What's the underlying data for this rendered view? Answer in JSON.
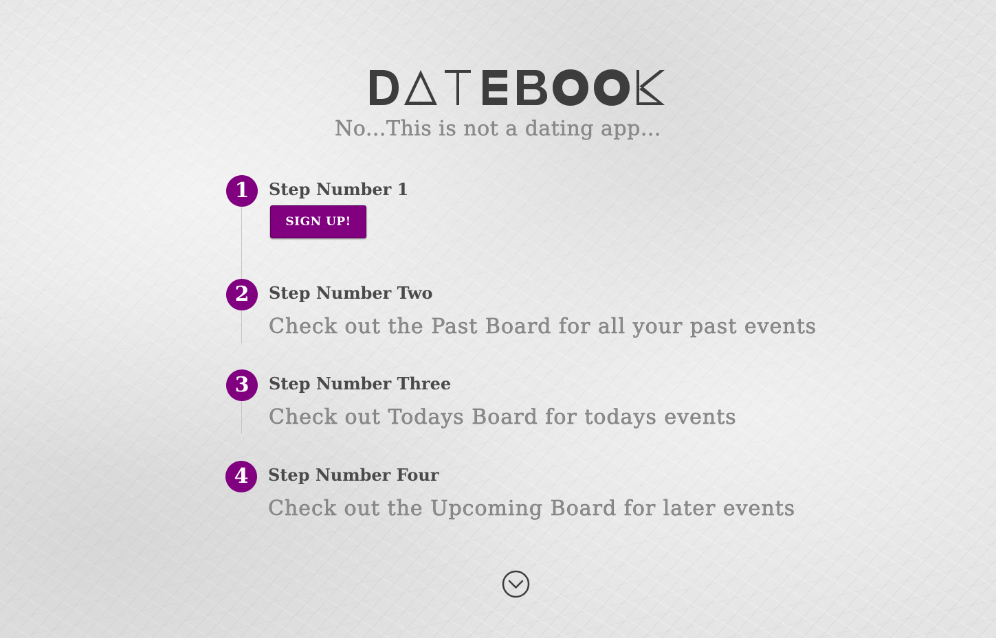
{
  "brand": {
    "logo_text": "DATEBOOK",
    "tagline": "No...This is not a dating app..."
  },
  "colors": {
    "accent": "#800080",
    "heading": "#4a4a4a",
    "muted": "#8c8c8c"
  },
  "steps": [
    {
      "number": "1",
      "title": "Step Number 1",
      "action_label": "SIGN UP!"
    },
    {
      "number": "2",
      "title": "Step Number Two",
      "description": "Check out the Past Board for all your past events"
    },
    {
      "number": "3",
      "title": "Step Number Three",
      "description": "Check out Todays Board for todays events"
    },
    {
      "number": "4",
      "title": "Step Number Four",
      "description": "Check out the Upcoming Board for later events"
    }
  ],
  "scroll": {
    "icon": "chevron-down-circle-icon"
  }
}
